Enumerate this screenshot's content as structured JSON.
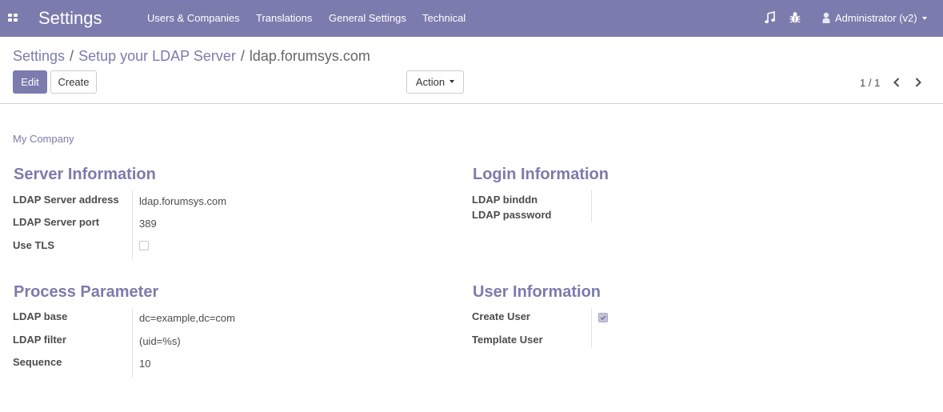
{
  "navbar": {
    "app_title": "Settings",
    "menus": [
      "Users & Companies",
      "Translations",
      "General Settings",
      "Technical"
    ],
    "user_label": "Administrator (v2)",
    "icons": [
      "apps-grid-icon",
      "music-note-icon",
      "bug-icon",
      "user-icon"
    ],
    "background_color": "#7c7bad"
  },
  "breadcrumb": {
    "items": [
      "Settings",
      "Setup your LDAP Server"
    ],
    "current": "ldap.forumsys.com"
  },
  "toolbar": {
    "edit_label": "Edit",
    "create_label": "Create",
    "action_label": "Action"
  },
  "pager": {
    "value": "1 / 1"
  },
  "form": {
    "company": "My Company",
    "server_information": {
      "title": "Server Information",
      "ldap_server_address_label": "LDAP Server address",
      "ldap_server_address": "ldap.forumsys.com",
      "ldap_server_port_label": "LDAP Server port",
      "ldap_server_port": "389",
      "use_tls_label": "Use TLS",
      "use_tls": false
    },
    "login_information": {
      "title": "Login Information",
      "ldap_binddn_label": "LDAP binddn",
      "ldap_binddn": "",
      "ldap_password_label": "LDAP password",
      "ldap_password": ""
    },
    "process_parameter": {
      "title": "Process Parameter",
      "ldap_base_label": "LDAP base",
      "ldap_base": "dc=example,dc=com",
      "ldap_filter_label": "LDAP filter",
      "ldap_filter": "(uid=%s)",
      "sequence_label": "Sequence",
      "sequence": "10"
    },
    "user_information": {
      "title": "User Information",
      "create_user_label": "Create User",
      "create_user": true,
      "template_user_label": "Template User",
      "template_user": ""
    }
  }
}
